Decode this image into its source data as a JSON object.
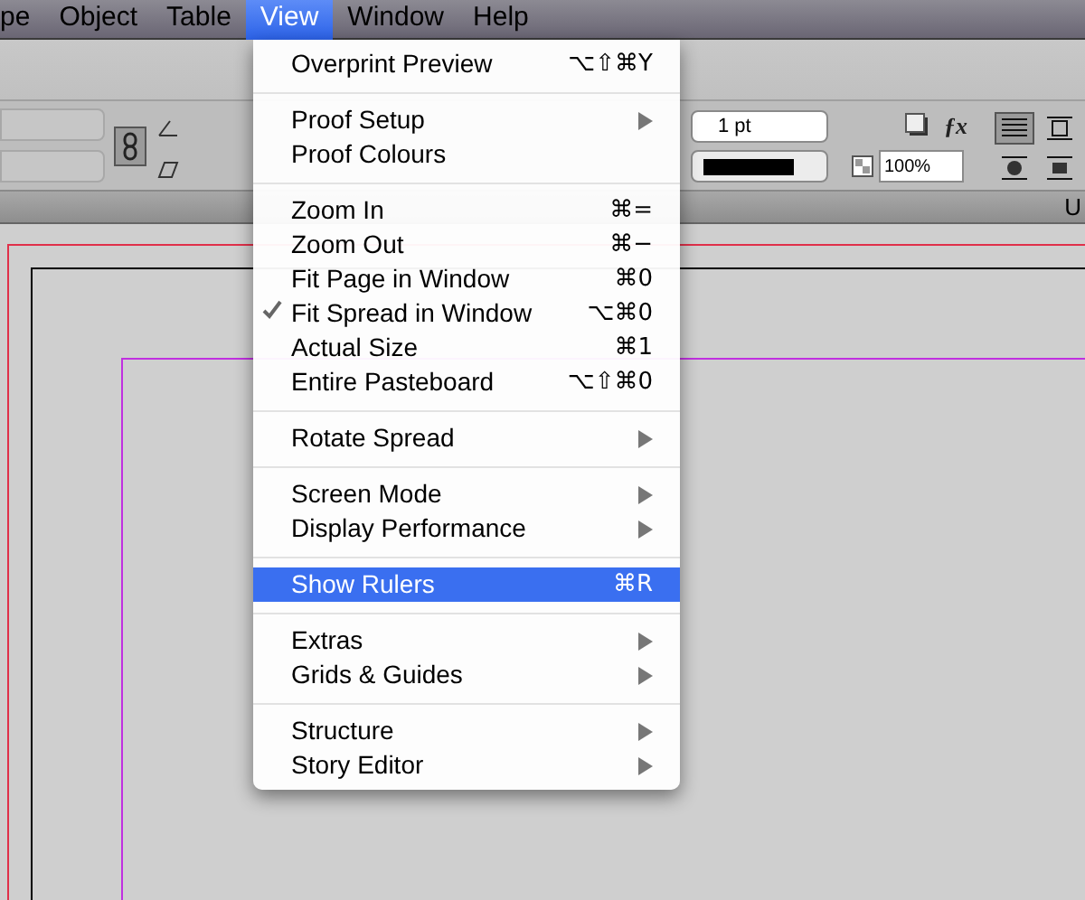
{
  "menu_bar": {
    "items": [
      {
        "label": "pe",
        "selected": false
      },
      {
        "label": "Object",
        "selected": false
      },
      {
        "label": "Table",
        "selected": false
      },
      {
        "label": "View",
        "selected": true
      },
      {
        "label": "Window",
        "selected": false
      },
      {
        "label": "Help",
        "selected": false
      }
    ]
  },
  "control_panel": {
    "stroke_weight": "1 pt",
    "opacity": "100%",
    "effects_label": "ƒx"
  },
  "document_tab": {
    "label": "U"
  },
  "view_menu": {
    "groups": [
      [
        {
          "label": "Overprint Preview",
          "shortcut": "⌥⇧⌘Y",
          "submenu": false,
          "checked": false,
          "selected": false
        }
      ],
      [
        {
          "label": "Proof Setup",
          "submenu": true,
          "checked": false,
          "selected": false
        },
        {
          "label": "Proof Colours",
          "submenu": false,
          "checked": false,
          "selected": false
        }
      ],
      [
        {
          "label": "Zoom In",
          "shortcut": "⌘=",
          "submenu": false,
          "checked": false,
          "selected": false
        },
        {
          "label": "Zoom Out",
          "shortcut": "⌘−",
          "submenu": false,
          "checked": false,
          "selected": false
        },
        {
          "label": "Fit Page in Window",
          "shortcut": "⌘0",
          "submenu": false,
          "checked": false,
          "selected": false
        },
        {
          "label": "Fit Spread in Window",
          "shortcut": "⌥⌘0",
          "submenu": false,
          "checked": true,
          "selected": false
        },
        {
          "label": "Actual Size",
          "shortcut": "⌘1",
          "submenu": false,
          "checked": false,
          "selected": false
        },
        {
          "label": "Entire Pasteboard",
          "shortcut": "⌥⇧⌘0",
          "submenu": false,
          "checked": false,
          "selected": false
        }
      ],
      [
        {
          "label": "Rotate Spread",
          "submenu": true,
          "checked": false,
          "selected": false
        }
      ],
      [
        {
          "label": "Screen Mode",
          "submenu": true,
          "checked": false,
          "selected": false
        },
        {
          "label": "Display Performance",
          "submenu": true,
          "checked": false,
          "selected": false
        }
      ],
      [
        {
          "label": "Show Rulers",
          "shortcut": "⌘R",
          "submenu": false,
          "checked": false,
          "selected": true
        }
      ],
      [
        {
          "label": "Extras",
          "submenu": true,
          "checked": false,
          "selected": false
        },
        {
          "label": "Grids & Guides",
          "submenu": true,
          "checked": false,
          "selected": false
        }
      ],
      [
        {
          "label": "Structure",
          "submenu": true,
          "checked": false,
          "selected": false
        },
        {
          "label": "Story Editor",
          "submenu": true,
          "checked": false,
          "selected": false
        }
      ]
    ]
  }
}
